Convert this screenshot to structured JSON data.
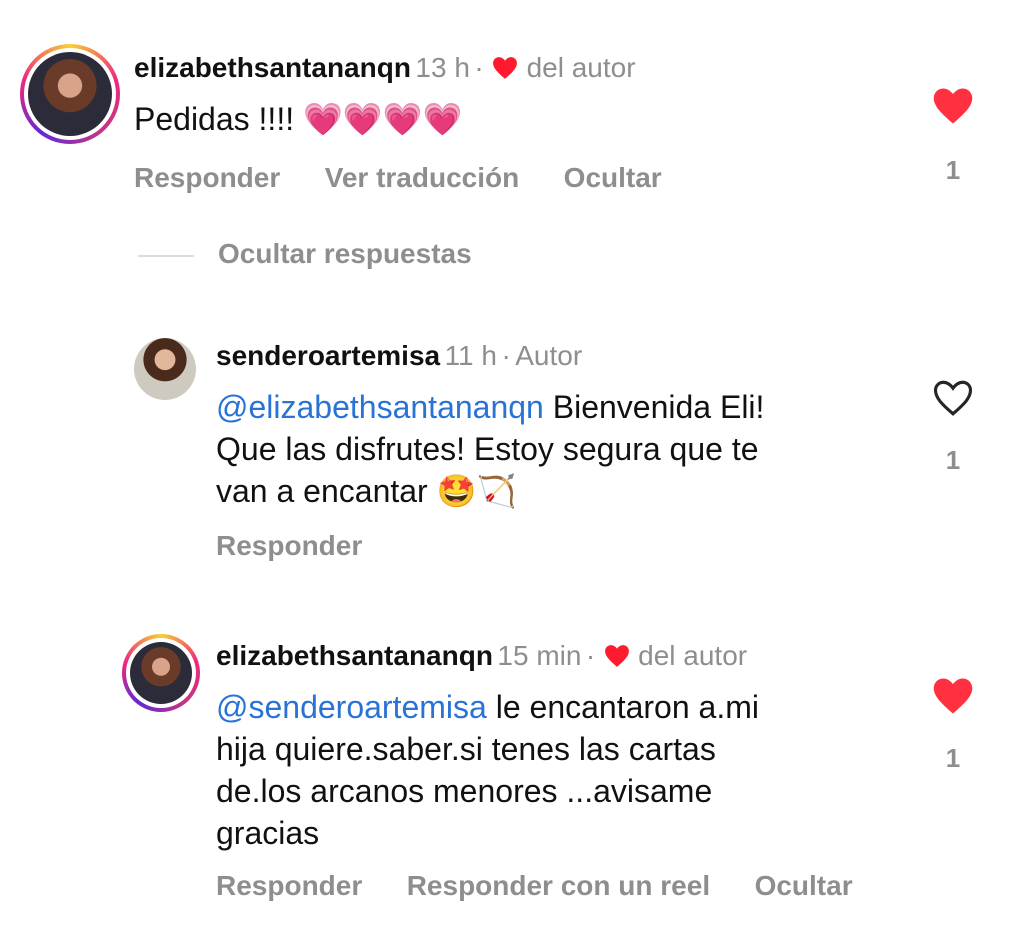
{
  "comments": [
    {
      "username": "elizabethsantananqn",
      "time": "13 h",
      "separator": "·",
      "tag": "del autor",
      "text": "Pedidas !!!!",
      "emojis": "💗💗💗💗",
      "actions": [
        "Responder",
        "Ver traducción",
        "Ocultar"
      ],
      "like_count": "1",
      "liked": true
    },
    {
      "username": "senderoartemisa",
      "time": "11 h",
      "separator": "·",
      "tag": "Autor",
      "mention": "@elizabethsantananqn",
      "text_line1": " Bienvenida Eli!",
      "text_line2": "Que las disfrutes! Estoy segura que te",
      "text_line3": "van a encantar",
      "emojis": "🤩🏹",
      "actions": [
        "Responder"
      ],
      "like_count": "1",
      "liked": false
    },
    {
      "username": "elizabethsantananqn",
      "time": "15 min",
      "separator": "·",
      "tag": "del autor",
      "mention": "@senderoartemisa",
      "text_line1": " le encantaron a.mi",
      "text_line2": "hija quiere.saber.si tenes las cartas",
      "text_line3": "de.los arcanos menores ...avisame",
      "text_line4": "gracias",
      "actions": [
        "Responder",
        "Responder con un reel",
        "Ocultar"
      ],
      "like_count": "1",
      "liked": true
    }
  ],
  "replies_toggle": "Ocultar respuestas",
  "colors": {
    "like_red": "#ff3040",
    "mention_blue": "#2a73d6",
    "muted": "#8e8e8e"
  }
}
